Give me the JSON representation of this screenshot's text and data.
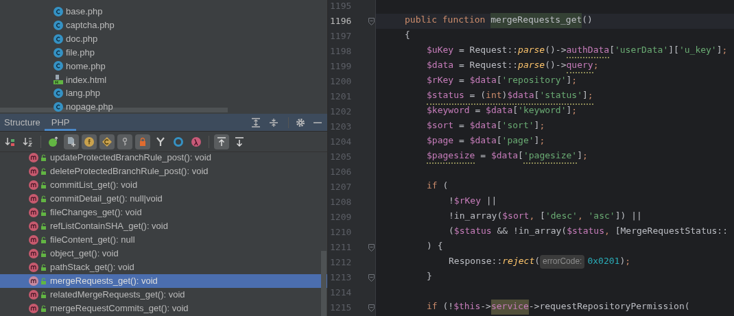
{
  "project_tree": {
    "files": [
      {
        "name": "base.php",
        "kind": "class"
      },
      {
        "name": "captcha.php",
        "kind": "class"
      },
      {
        "name": "doc.php",
        "kind": "class"
      },
      {
        "name": "file.php",
        "kind": "class"
      },
      {
        "name": "home.php",
        "kind": "class"
      },
      {
        "name": "index.html",
        "kind": "html"
      },
      {
        "name": "lang.php",
        "kind": "class"
      },
      {
        "name": "nopage.php",
        "kind": "class"
      }
    ]
  },
  "tool_window": {
    "tabs": [
      {
        "label": "Structure",
        "selected": false
      },
      {
        "label": "PHP",
        "selected": true
      }
    ],
    "toolbar": [
      {
        "kind": "sort-visibility",
        "on": false
      },
      {
        "kind": "sort-alpha",
        "on": false
      },
      {
        "kind": "sep"
      },
      {
        "kind": "inherited",
        "on": false
      },
      {
        "kind": "include",
        "on": true
      },
      {
        "kind": "fields",
        "on": true
      },
      {
        "kind": "constants",
        "on": true
      },
      {
        "kind": "key",
        "on": true
      },
      {
        "kind": "private",
        "on": true
      },
      {
        "kind": "merge",
        "on": false
      },
      {
        "kind": "ring",
        "on": false
      },
      {
        "kind": "lambda",
        "on": false
      },
      {
        "kind": "sep"
      },
      {
        "kind": "scroll-to",
        "on": true
      },
      {
        "kind": "scroll-from",
        "on": false
      }
    ],
    "members": [
      {
        "label": "updateProtectedBranchRule_post(): void",
        "selected": false
      },
      {
        "label": "deleteProtectedBranchRule_post(): void",
        "selected": false
      },
      {
        "label": "commitList_get(): void",
        "selected": false
      },
      {
        "label": "commitDetail_get(): null|void",
        "selected": false
      },
      {
        "label": "fileChanges_get(): void",
        "selected": false
      },
      {
        "label": "refListContainSHA_get(): void",
        "selected": false
      },
      {
        "label": "fileContent_get(): null",
        "selected": false
      },
      {
        "label": "object_get(): void",
        "selected": false
      },
      {
        "label": "pathStack_get(): void",
        "selected": false
      },
      {
        "label": "mergeRequests_get(): void",
        "selected": true
      },
      {
        "label": "relatedMergeRequests_get(): void",
        "selected": false
      },
      {
        "label": "mergeRequestCommits_get(): void",
        "selected": false
      }
    ]
  },
  "editor": {
    "lines": [
      {
        "number": "1195",
        "current": false,
        "fold": false
      },
      {
        "number": "1196",
        "current": true,
        "fold": true,
        "kind": "member",
        "tokens": [
          {
            "kind": "kw",
            "text": "public function "
          },
          {
            "kind": "decl",
            "text": "mergeRequests_get"
          },
          {
            "kind": "plain",
            "text": "()"
          }
        ]
      },
      {
        "number": "1197",
        "current": false,
        "fold": false,
        "kind": "member",
        "tokens": [
          {
            "kind": "plain",
            "text": "{"
          }
        ]
      },
      {
        "number": "1198",
        "current": false,
        "fold": false,
        "kind": "body",
        "tokens": [
          {
            "kind": "var",
            "text": "$uKey"
          },
          {
            "kind": "plain",
            "text": " = Request::"
          },
          {
            "kind": "call",
            "text": "parse"
          },
          {
            "kind": "plain",
            "text": "()->"
          },
          {
            "kind": "field",
            "text": "authData",
            "warn": true
          },
          {
            "kind": "plain",
            "text": "["
          },
          {
            "kind": "str",
            "text": "'userData'"
          },
          {
            "kind": "plain",
            "text": "]["
          },
          {
            "kind": "str",
            "text": "'u_key'"
          },
          {
            "kind": "plain",
            "text": "]"
          },
          {
            "kind": "punct",
            "text": ";"
          }
        ]
      },
      {
        "number": "1199",
        "current": false,
        "fold": false,
        "kind": "body",
        "tokens": [
          {
            "kind": "var",
            "text": "$data"
          },
          {
            "kind": "plain",
            "text": " = Request::"
          },
          {
            "kind": "call",
            "text": "parse"
          },
          {
            "kind": "plain",
            "text": "()->"
          },
          {
            "kind": "field",
            "text": "query",
            "warn": true
          },
          {
            "kind": "punct",
            "text": ";"
          }
        ]
      },
      {
        "number": "1200",
        "current": false,
        "fold": false,
        "kind": "body",
        "tokens": [
          {
            "kind": "var",
            "text": "$rKey"
          },
          {
            "kind": "plain",
            "text": " = "
          },
          {
            "kind": "var",
            "text": "$data"
          },
          {
            "kind": "plain",
            "text": "["
          },
          {
            "kind": "str",
            "text": "'repository'"
          },
          {
            "kind": "plain",
            "text": "]"
          },
          {
            "kind": "punct",
            "text": ";"
          }
        ]
      },
      {
        "number": "1201",
        "current": false,
        "fold": false,
        "kind": "body",
        "warn": true,
        "tokens": [
          {
            "kind": "var",
            "text": "$status"
          },
          {
            "kind": "plain",
            "text": " = ("
          },
          {
            "kind": "kw",
            "text": "int"
          },
          {
            "kind": "plain",
            "text": ")"
          },
          {
            "kind": "var",
            "text": "$data"
          },
          {
            "kind": "plain",
            "text": "["
          },
          {
            "kind": "str",
            "text": "'status'"
          },
          {
            "kind": "plain",
            "text": "]"
          },
          {
            "kind": "punct",
            "text": ";"
          }
        ]
      },
      {
        "number": "1202",
        "current": false,
        "fold": false,
        "kind": "body",
        "tokens": [
          {
            "kind": "var",
            "text": "$keyword"
          },
          {
            "kind": "plain",
            "text": " = "
          },
          {
            "kind": "var",
            "text": "$data"
          },
          {
            "kind": "plain",
            "text": "["
          },
          {
            "kind": "str",
            "text": "'keyword'"
          },
          {
            "kind": "plain",
            "text": "]"
          },
          {
            "kind": "punct",
            "text": ";"
          }
        ]
      },
      {
        "number": "1203",
        "current": false,
        "fold": false,
        "kind": "body",
        "tokens": [
          {
            "kind": "var",
            "text": "$sort"
          },
          {
            "kind": "plain",
            "text": " = "
          },
          {
            "kind": "var",
            "text": "$data"
          },
          {
            "kind": "plain",
            "text": "["
          },
          {
            "kind": "str",
            "text": "'sort'"
          },
          {
            "kind": "plain",
            "text": "]"
          },
          {
            "kind": "punct",
            "text": ";"
          }
        ]
      },
      {
        "number": "1204",
        "current": false,
        "fold": false,
        "kind": "body",
        "tokens": [
          {
            "kind": "var",
            "text": "$page"
          },
          {
            "kind": "plain",
            "text": " = "
          },
          {
            "kind": "var",
            "text": "$data"
          },
          {
            "kind": "plain",
            "text": "["
          },
          {
            "kind": "str",
            "text": "'page'"
          },
          {
            "kind": "plain",
            "text": "]"
          },
          {
            "kind": "punct",
            "text": ";"
          }
        ]
      },
      {
        "number": "1205",
        "current": false,
        "fold": false,
        "kind": "body",
        "tokens": [
          {
            "kind": "var",
            "text": "$pagesize",
            "warn": true
          },
          {
            "kind": "plain",
            "text": " = "
          },
          {
            "kind": "var",
            "text": "$data"
          },
          {
            "kind": "plain",
            "text": "["
          },
          {
            "kind": "str",
            "text": "'pagesize'",
            "warn": true
          },
          {
            "kind": "plain",
            "text": "]"
          },
          {
            "kind": "punct",
            "text": ";"
          }
        ]
      },
      {
        "number": "1206",
        "current": false,
        "fold": false
      },
      {
        "number": "1207",
        "current": false,
        "fold": false,
        "kind": "body",
        "tokens": [
          {
            "kind": "kw",
            "text": "if"
          },
          {
            "kind": "plain",
            "text": " ("
          }
        ]
      },
      {
        "number": "1208",
        "current": false,
        "fold": false,
        "kind": "nested",
        "tokens": [
          {
            "kind": "plain",
            "text": "!"
          },
          {
            "kind": "var",
            "text": "$rKey"
          },
          {
            "kind": "plain",
            "text": " ||"
          }
        ]
      },
      {
        "number": "1209",
        "current": false,
        "fold": false,
        "kind": "nested",
        "tokens": [
          {
            "kind": "plain",
            "text": "!in_array("
          },
          {
            "kind": "var",
            "text": "$sort"
          },
          {
            "kind": "punct",
            "text": ","
          },
          {
            "kind": "plain",
            "text": " ["
          },
          {
            "kind": "str",
            "text": "'desc'"
          },
          {
            "kind": "punct",
            "text": ","
          },
          {
            "kind": "str",
            "text": " 'asc'"
          },
          {
            "kind": "plain",
            "text": "]) ||"
          }
        ]
      },
      {
        "number": "1210",
        "current": false,
        "fold": false,
        "kind": "nested",
        "tokens": [
          {
            "kind": "plain",
            "text": "("
          },
          {
            "kind": "var",
            "text": "$status"
          },
          {
            "kind": "plain",
            "text": " && !in_array("
          },
          {
            "kind": "var",
            "text": "$status"
          },
          {
            "kind": "punct",
            "text": ","
          },
          {
            "kind": "plain",
            "text": " [MergeRequestStatus::"
          }
        ]
      },
      {
        "number": "1211",
        "current": false,
        "fold": true,
        "kind": "body",
        "tokens": [
          {
            "kind": "plain",
            "text": ") {"
          }
        ]
      },
      {
        "number": "1212",
        "current": false,
        "fold": false,
        "kind": "nested",
        "tokens": [
          {
            "kind": "plain",
            "text": "Response::"
          },
          {
            "kind": "call",
            "text": "reject"
          },
          {
            "kind": "plain",
            "text": "("
          },
          {
            "kind": "hint",
            "text": "errorCode:"
          },
          {
            "kind": "num",
            "text": "0x0201"
          },
          {
            "kind": "plain",
            "text": ")"
          },
          {
            "kind": "punct",
            "text": ";"
          }
        ]
      },
      {
        "number": "1213",
        "current": false,
        "fold": true,
        "kind": "body",
        "tokens": [
          {
            "kind": "plain",
            "text": "}"
          }
        ]
      },
      {
        "number": "1214",
        "current": false,
        "fold": false
      },
      {
        "number": "1215",
        "current": false,
        "fold": true,
        "kind": "body",
        "tokens": [
          {
            "kind": "kw",
            "text": "if"
          },
          {
            "kind": "plain",
            "text": " (!"
          },
          {
            "kind": "var",
            "text": "$this"
          },
          {
            "kind": "plain",
            "text": "->"
          },
          {
            "kind": "usage",
            "text": "service"
          },
          {
            "kind": "plain",
            "text": "->requestRepositoryPermission("
          }
        ]
      }
    ]
  }
}
